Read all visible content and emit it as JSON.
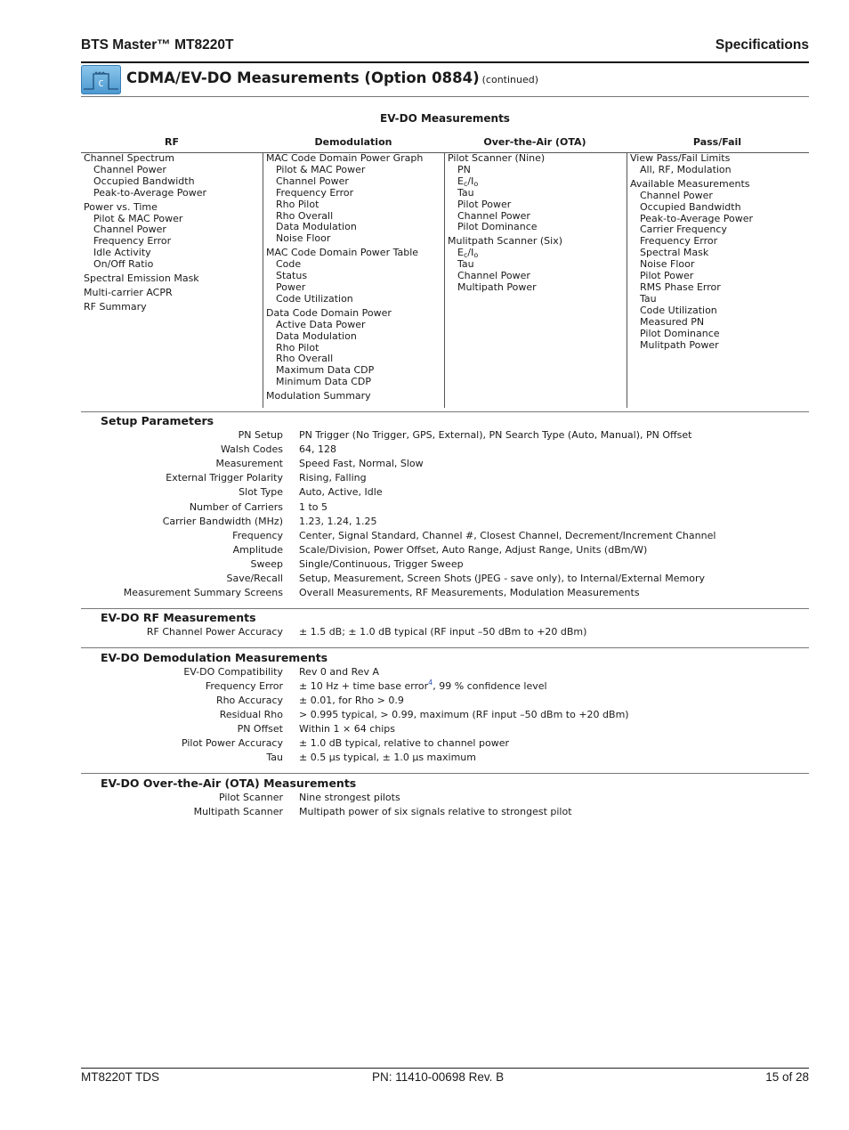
{
  "header": {
    "product": "BTS Master™ MT8220T",
    "section": "Specifications"
  },
  "title": {
    "icon": "cdma-option-icon",
    "icon_letter": "C",
    "text": "CDMA/EV-DO Measurements (Option 0884)",
    "continued": "(continued)"
  },
  "evdo_measurements": {
    "title": "EV-DO Measurements",
    "columns": [
      {
        "header": "RF",
        "groups": [
          {
            "heading": "Channel Spectrum",
            "items": [
              "Channel Power",
              "Occupied Bandwidth",
              "Peak-to-Average Power"
            ]
          },
          {
            "heading": "Power vs. Time",
            "items": [
              "Pilot & MAC Power",
              "Channel Power",
              "Frequency Error",
              "Idle Activity",
              "On/Off Ratio"
            ]
          },
          {
            "heading": "Spectral Emission Mask",
            "items": []
          },
          {
            "heading": "Multi-carrier ACPR",
            "items": []
          },
          {
            "heading": "RF Summary",
            "items": []
          }
        ]
      },
      {
        "header": "Demodulation",
        "groups": [
          {
            "heading": "MAC Code Domain Power Graph",
            "items": [
              "Pilot & MAC Power",
              "Channel Power",
              "Frequency Error",
              "Rho Pilot",
              "Rho Overall",
              "Data Modulation",
              "Noise Floor"
            ]
          },
          {
            "heading": "MAC Code Domain Power Table",
            "items": [
              "Code",
              "Status",
              "Power",
              "Code Utilization"
            ]
          },
          {
            "heading": "Data Code Domain Power",
            "items": [
              "Active Data Power",
              "Data Modulation",
              "Rho Pilot",
              "Rho Overall",
              "Maximum Data CDP",
              "Minimum Data CDP"
            ]
          },
          {
            "heading": "Modulation Summary",
            "items": []
          }
        ]
      },
      {
        "header": "Over-the-Air (OTA)",
        "groups": [
          {
            "heading": "Pilot Scanner (Nine)",
            "items": [
              "PN",
              "Ec/Io",
              "Tau",
              "Pilot Power",
              "Channel Power",
              "Pilot Dominance"
            ]
          },
          {
            "heading": "Mulitpath Scanner (Six)",
            "items": [
              "Ec/Io",
              "Tau",
              "Channel Power",
              "Multipath Power"
            ]
          }
        ]
      },
      {
        "header": "Pass/Fail",
        "groups": [
          {
            "heading": "View Pass/Fail Limits",
            "items": [
              "All, RF, Modulation"
            ]
          },
          {
            "heading": "Available Measurements",
            "items": [
              "Channel Power",
              "Occupied Bandwidth",
              "Peak-to-Average Power",
              "Carrier Frequency",
              "Frequency Error",
              "Spectral Mask",
              "Noise Floor",
              "Pilot Power",
              "RMS Phase Error",
              "Tau",
              "Code Utilization",
              "Measured PN",
              "Pilot Dominance",
              "Mulitpath Power"
            ]
          }
        ]
      }
    ]
  },
  "setup_parameters": {
    "title": "Setup Parameters",
    "rows": [
      {
        "label": "PN Setup",
        "value": "PN Trigger (No Trigger, GPS, External), PN Search Type (Auto, Manual), PN Offset"
      },
      {
        "label": "Walsh Codes",
        "value": "64, 128"
      },
      {
        "label": "Measurement",
        "value": "Speed Fast, Normal, Slow"
      },
      {
        "label": "External Trigger Polarity",
        "value": "Rising, Falling"
      },
      {
        "label": "Slot Type",
        "value": "Auto, Active, Idle"
      },
      {
        "label": "Number of Carriers",
        "value": "1 to 5"
      },
      {
        "label": "Carrier Bandwidth (MHz)",
        "value": "1.23, 1.24, 1.25"
      },
      {
        "label": "Frequency",
        "value": "Center, Signal Standard, Channel #, Closest Channel, Decrement/Increment Channel"
      },
      {
        "label": "Amplitude",
        "value": "Scale/Division, Power Offset, Auto Range, Adjust Range, Units (dBm/W)"
      },
      {
        "label": "Sweep",
        "value": "Single/Continuous, Trigger Sweep"
      },
      {
        "label": "Save/Recall",
        "value": "Setup, Measurement, Screen Shots (JPEG - save only), to Internal/External Memory"
      },
      {
        "label": "Measurement Summary Screens",
        "value": "Overall Measurements, RF Measurements, Modulation Measurements"
      }
    ]
  },
  "rf_measurements": {
    "title": "EV-DO RF Measurements",
    "rows": [
      {
        "label": "RF Channel Power Accuracy",
        "value": "± 1.5 dB; ± 1.0 dB typical (RF input –50 dBm to +20 dBm)"
      }
    ]
  },
  "demod_measurements": {
    "title": "EV-DO Demodulation Measurements",
    "rows": [
      {
        "label": "EV-DO Compatibility",
        "value": "Rev 0 and Rev A"
      },
      {
        "label": "Frequency Error",
        "value": "± 10 Hz + time base error",
        "footnote": "4",
        "value_suffix": ", 99 % confidence level"
      },
      {
        "label": "Rho Accuracy",
        "value": "± 0.01, for Rho > 0.9"
      },
      {
        "label": "Residual Rho",
        "value": "> 0.995 typical, > 0.99, maximum (RF input –50 dBm to +20 dBm)"
      },
      {
        "label": "PN Offset",
        "value": "Within 1 × 64 chips"
      },
      {
        "label": "Pilot Power Accuracy",
        "value": "± 1.0 dB typical, relative to channel power"
      },
      {
        "label": "Tau",
        "value": "± 0.5 µs typical, ± 1.0 µs maximum"
      }
    ]
  },
  "ota_measurements": {
    "title": "EV-DO Over-the-Air (OTA) Measurements",
    "rows": [
      {
        "label": "Pilot Scanner",
        "value": "Nine strongest pilots"
      },
      {
        "label": "Multipath Scanner",
        "value": "Multipath power of six signals relative to strongest pilot"
      }
    ]
  },
  "footer": {
    "doc": "MT8220T TDS",
    "part_number": "PN: 11410-00698  Rev. B",
    "page": "15 of 28"
  }
}
